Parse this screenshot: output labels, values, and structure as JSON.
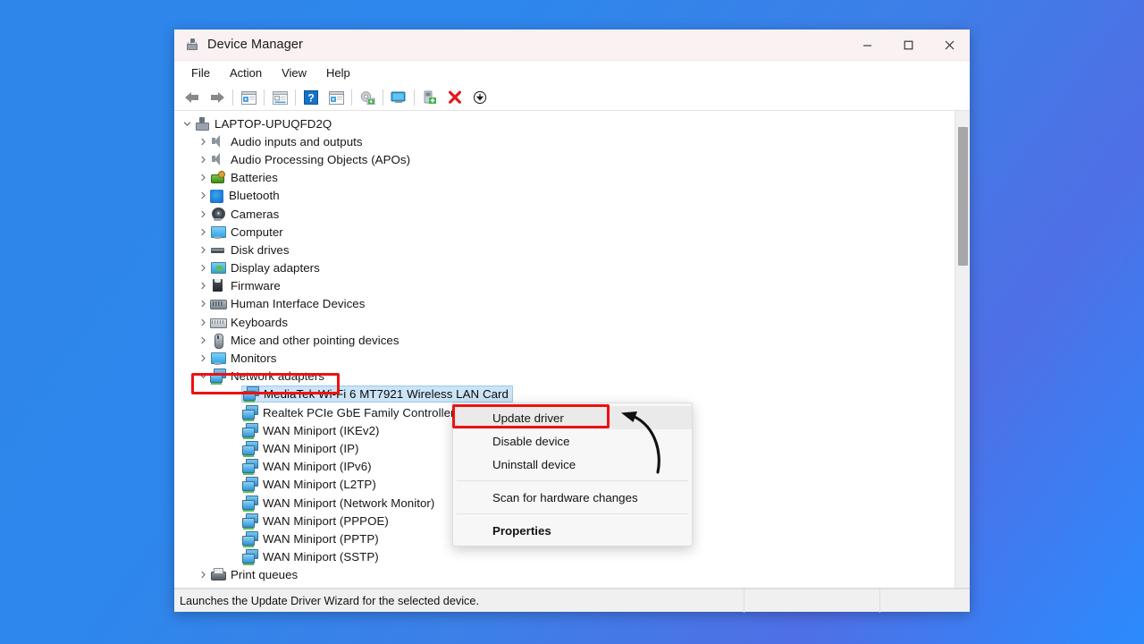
{
  "window": {
    "title": "Device Manager",
    "app_icon": "device-manager-icon",
    "controls": {
      "minimize": "Minimize",
      "maximize": "Maximize",
      "close": "Close"
    }
  },
  "menubar": {
    "items": [
      {
        "label": "File"
      },
      {
        "label": "Action"
      },
      {
        "label": "View"
      },
      {
        "label": "Help"
      }
    ]
  },
  "toolbar": {
    "buttons": [
      {
        "name": "back-icon",
        "title": "Back"
      },
      {
        "name": "forward-icon",
        "title": "Forward"
      },
      {
        "name": "show-hide-console-tree-icon",
        "title": "Show/Hide Console Tree"
      },
      {
        "name": "properties-icon",
        "title": "Properties"
      },
      {
        "name": "help-icon",
        "title": "Help"
      },
      {
        "name": "view-icon",
        "title": "View"
      },
      {
        "name": "update-driver-icon",
        "title": "Update driver"
      },
      {
        "name": "scan-for-hardware-changes-icon",
        "title": "Scan for hardware changes"
      },
      {
        "name": "enable-device-icon",
        "title": "Enable device"
      },
      {
        "name": "uninstall-device-icon",
        "title": "Uninstall device"
      },
      {
        "name": "disable-device-icon",
        "title": "Disable device"
      }
    ]
  },
  "tree": {
    "rows": [
      {
        "label": "LAPTOP-UPUQFD2Q",
        "level": 0,
        "chevron": "down",
        "icon": "ic-root",
        "selected": false
      },
      {
        "label": "Audio inputs and outputs",
        "level": 1,
        "chevron": "right",
        "icon": "ic-speaker",
        "selected": false
      },
      {
        "label": "Audio Processing Objects (APOs)",
        "level": 1,
        "chevron": "right",
        "icon": "ic-speaker",
        "selected": false
      },
      {
        "label": "Batteries",
        "level": 1,
        "chevron": "right",
        "icon": "ic-battery",
        "selected": false
      },
      {
        "label": "Bluetooth",
        "level": 1,
        "chevron": "right",
        "icon": "ic-bluetooth",
        "selected": false
      },
      {
        "label": "Cameras",
        "level": 1,
        "chevron": "right",
        "icon": "ic-camera",
        "selected": false
      },
      {
        "label": "Computer",
        "level": 1,
        "chevron": "right",
        "icon": "ic-monitor",
        "selected": false
      },
      {
        "label": "Disk drives",
        "level": 1,
        "chevron": "right",
        "icon": "ic-disk",
        "selected": false
      },
      {
        "label": "Display adapters",
        "level": 1,
        "chevron": "right",
        "icon": "ic-display",
        "selected": false
      },
      {
        "label": "Firmware",
        "level": 1,
        "chevron": "right",
        "icon": "ic-firmware",
        "selected": false
      },
      {
        "label": "Human Interface Devices",
        "level": 1,
        "chevron": "right",
        "icon": "ic-hid",
        "selected": false
      },
      {
        "label": "Keyboards",
        "level": 1,
        "chevron": "right",
        "icon": "ic-keyboard",
        "selected": false
      },
      {
        "label": "Mice and other pointing devices",
        "level": 1,
        "chevron": "right",
        "icon": "ic-mouse",
        "selected": false
      },
      {
        "label": "Monitors",
        "level": 1,
        "chevron": "right",
        "icon": "ic-monitor",
        "selected": false
      },
      {
        "label": "Network adapters",
        "level": 1,
        "chevron": "down",
        "icon": "ic-network",
        "selected": false
      },
      {
        "label": "MediaTek Wi-Fi 6 MT7921 Wireless LAN Card",
        "level": 2,
        "chevron": "none",
        "icon": "ic-network",
        "selected": true
      },
      {
        "label": "Realtek PCIe GbE Family Controller",
        "level": 2,
        "chevron": "none",
        "icon": "ic-network",
        "selected": false
      },
      {
        "label": "WAN Miniport (IKEv2)",
        "level": 2,
        "chevron": "none",
        "icon": "ic-network",
        "selected": false
      },
      {
        "label": "WAN Miniport (IP)",
        "level": 2,
        "chevron": "none",
        "icon": "ic-network",
        "selected": false
      },
      {
        "label": "WAN Miniport (IPv6)",
        "level": 2,
        "chevron": "none",
        "icon": "ic-network",
        "selected": false
      },
      {
        "label": "WAN Miniport (L2TP)",
        "level": 2,
        "chevron": "none",
        "icon": "ic-network",
        "selected": false
      },
      {
        "label": "WAN Miniport (Network Monitor)",
        "level": 2,
        "chevron": "none",
        "icon": "ic-network",
        "selected": false
      },
      {
        "label": "WAN Miniport (PPPOE)",
        "level": 2,
        "chevron": "none",
        "icon": "ic-network",
        "selected": false
      },
      {
        "label": "WAN Miniport (PPTP)",
        "level": 2,
        "chevron": "none",
        "icon": "ic-network",
        "selected": false
      },
      {
        "label": "WAN Miniport (SSTP)",
        "level": 2,
        "chevron": "none",
        "icon": "ic-network",
        "selected": false
      },
      {
        "label": "Print queues",
        "level": 1,
        "chevron": "right",
        "icon": "ic-printer",
        "selected": false
      }
    ]
  },
  "context_menu": {
    "items": [
      {
        "label": "Update driver",
        "highlighted": true,
        "bold": false
      },
      {
        "label": "Disable device",
        "highlighted": false,
        "bold": false
      },
      {
        "label": "Uninstall device",
        "highlighted": false,
        "bold": false
      },
      {
        "separator": true
      },
      {
        "label": "Scan for hardware changes",
        "highlighted": false,
        "bold": false
      },
      {
        "separator": true
      },
      {
        "label": "Properties",
        "highlighted": false,
        "bold": true
      }
    ]
  },
  "statusbar": {
    "text": "Launches the Update Driver Wizard for the selected device."
  },
  "annotations": {
    "highlight_color": "#ee1111",
    "boxes": [
      {
        "name": "network-adapters-highlight",
        "target": "Network adapters"
      },
      {
        "name": "update-driver-highlight",
        "target": "Update driver"
      }
    ],
    "arrow": {
      "name": "pointer-arrow",
      "points_to": "Update driver"
    }
  },
  "colors": {
    "desktop_gradient_start": "#2f86ea",
    "desktop_gradient_end": "#2b8bfd",
    "titlebar": "#faf1f2",
    "selection": "#cce4f7",
    "accent_red": "#ee1111"
  }
}
